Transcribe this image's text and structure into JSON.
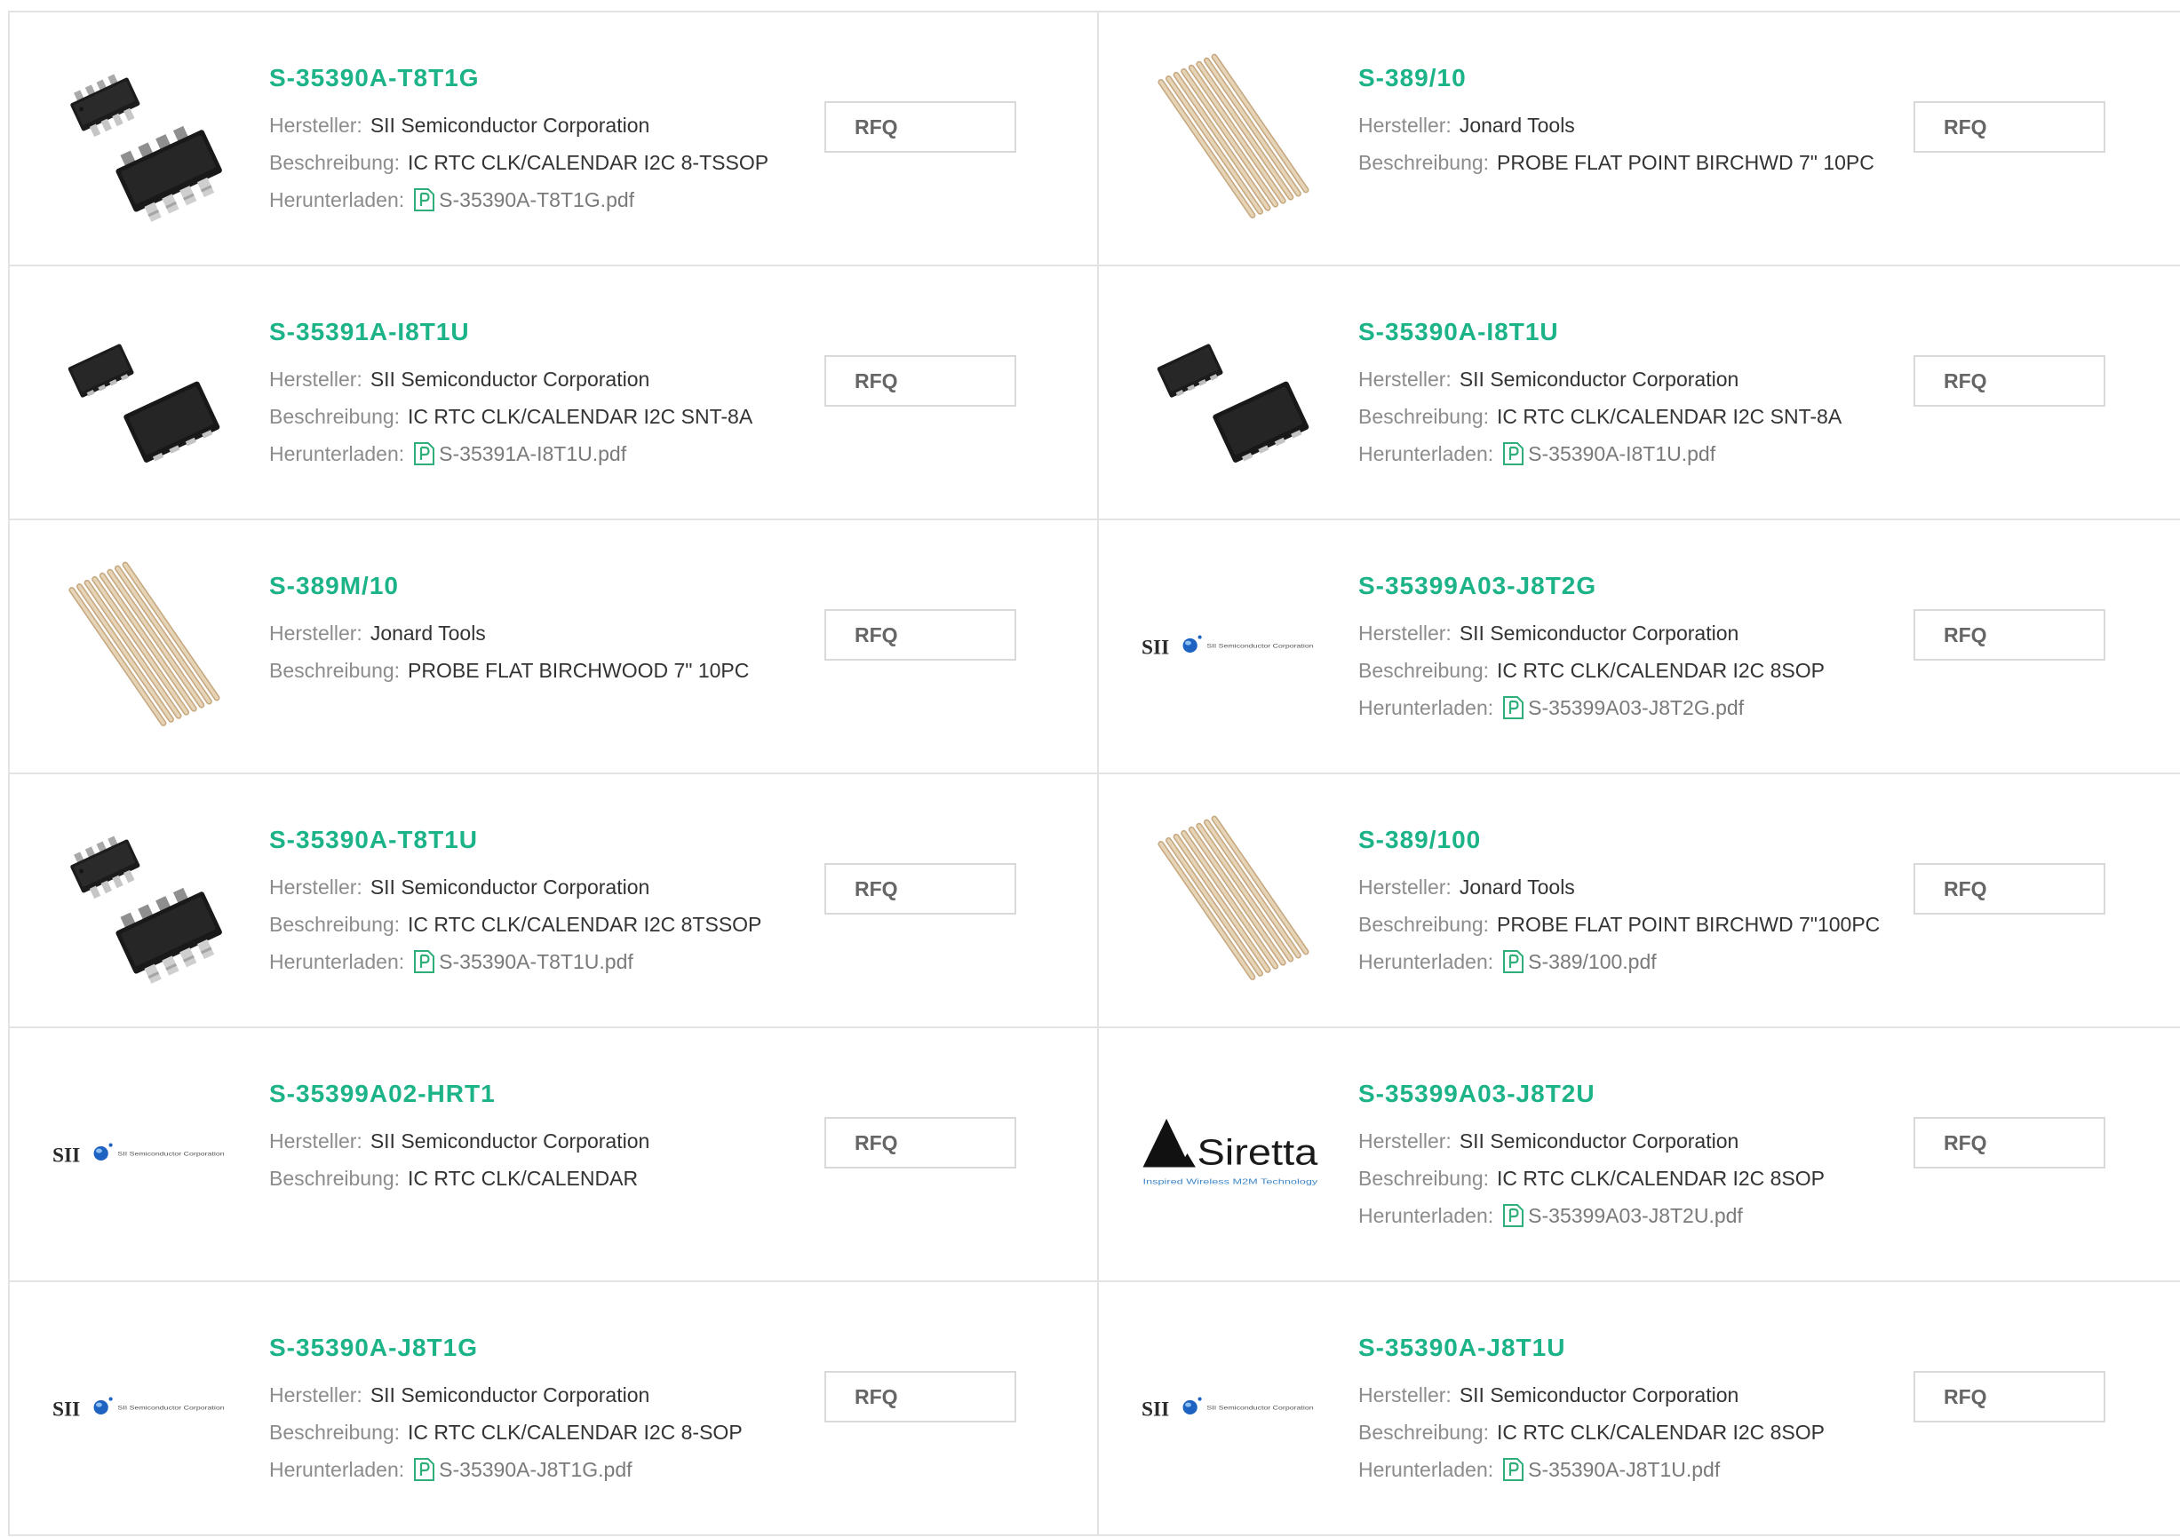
{
  "labels": {
    "manufacturer": "Hersteller:",
    "description": "Beschreibung:",
    "download": "Herunterladen:",
    "rfq": "RFQ"
  },
  "icons": {
    "datasheet": "pdf-icon"
  },
  "colors": {
    "accent": "#1bb387",
    "label": "#8c8c8c",
    "value": "#333333",
    "link": "#7a7a7a",
    "border": "#e3e3e3",
    "button-border": "#d9d9d9",
    "button-text": "#666666",
    "pdf-icon": "#2eae78"
  },
  "logos": {
    "sii": {
      "wordmark": "SII",
      "tagline": "SII Semiconductor Corporation"
    },
    "siretta": {
      "wordmark": "Siretta",
      "tagline": "Inspired Wireless M2M Technology"
    }
  },
  "products": [
    {
      "part": "S-35390A-T8T1G",
      "manufacturer": "SII Semiconductor Corporation",
      "description": "IC RTC CLK/CALENDAR I2C 8-TSSOP",
      "download": "S-35390A-T8T1G.pdf",
      "image": "tssop-chip-image"
    },
    {
      "part": "S-389/10",
      "manufacturer": "Jonard Tools",
      "description": "PROBE FLAT POINT BIRCHWD 7\" 10PC",
      "image": "probe-sticks-image"
    },
    {
      "part": "S-35391A-I8T1U",
      "manufacturer": "SII Semiconductor Corporation",
      "description": "IC RTC CLK/CALENDAR I2C SNT-8A",
      "download": "S-35391A-I8T1U.pdf",
      "image": "snt-chip-image"
    },
    {
      "part": "S-35390A-I8T1U",
      "manufacturer": "SII Semiconductor Corporation",
      "description": "IC RTC CLK/CALENDAR I2C SNT-8A",
      "download": "S-35390A-I8T1U.pdf",
      "image": "snt-chip-image"
    },
    {
      "part": "S-389M/10",
      "manufacturer": "Jonard Tools",
      "description": "PROBE FLAT BIRCHWOOD 7\" 10PC",
      "image": "probe-sticks-image"
    },
    {
      "part": "S-35399A03-J8T2G",
      "manufacturer": "SII Semiconductor Corporation",
      "description": "IC RTC CLK/CALENDAR I2C 8SOP",
      "download": "S-35399A03-J8T2G.pdf",
      "image": "sii-logo-image"
    },
    {
      "part": "S-35390A-T8T1U",
      "manufacturer": "SII Semiconductor Corporation",
      "description": "IC RTC CLK/CALENDAR I2C 8TSSOP",
      "download": "S-35390A-T8T1U.pdf",
      "image": "tssop-chip-image"
    },
    {
      "part": "S-389/100",
      "manufacturer": "Jonard Tools",
      "description": "PROBE FLAT POINT BIRCHWD 7\"100PC",
      "download": "S-389/100.pdf",
      "image": "probe-sticks-image"
    },
    {
      "part": "S-35399A02-HRT1",
      "manufacturer": "SII Semiconductor Corporation",
      "description": "IC RTC CLK/CALENDAR",
      "image": "sii-logo-image"
    },
    {
      "part": "S-35399A03-J8T2U",
      "manufacturer": "SII Semiconductor Corporation",
      "description": "IC RTC CLK/CALENDAR I2C 8SOP",
      "download": "S-35399A03-J8T2U.pdf",
      "image": "siretta-logo-image"
    },
    {
      "part": "S-35390A-J8T1G",
      "manufacturer": "SII Semiconductor Corporation",
      "description": "IC RTC CLK/CALENDAR I2C 8-SOP",
      "download": "S-35390A-J8T1G.pdf",
      "image": "sii-logo-image"
    },
    {
      "part": "S-35390A-J8T1U",
      "manufacturer": "SII Semiconductor Corporation",
      "description": "IC RTC CLK/CALENDAR I2C 8SOP",
      "download": "S-35390A-J8T1U.pdf",
      "image": "sii-logo-image"
    }
  ]
}
